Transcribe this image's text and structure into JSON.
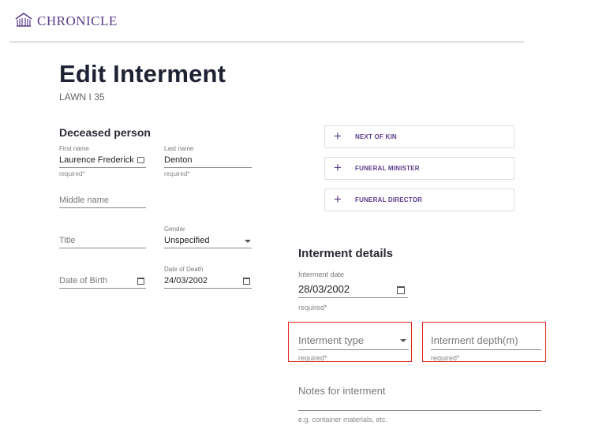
{
  "header": {
    "logo_text": "CHRONICLE",
    "logo_icon": "building-arches-icon",
    "brand_color": "#5b3d8a"
  },
  "page": {
    "title": "Edit Interment",
    "subtitle": "LAWN I 35"
  },
  "deceased": {
    "heading": "Deceased person",
    "first_name": {
      "label": "First name",
      "value": "Laurence Frederick",
      "hint": "required*"
    },
    "last_name": {
      "label": "Last name",
      "value": "Denton",
      "hint": "required*"
    },
    "middle_name": {
      "placeholder": "Middle name"
    },
    "title": {
      "placeholder": "Title"
    },
    "gender": {
      "label": "Gender",
      "value": "Unspecified"
    },
    "date_of_birth": {
      "placeholder": "Date of Birth"
    },
    "date_of_death": {
      "label": "Date of Death",
      "value": "24/03/2002"
    }
  },
  "contacts": {
    "next_of_kin": "NEXT OF KIN",
    "funeral_minister": "FUNERAL MINISTER",
    "funeral_director": "FUNERAL DIRECTOR"
  },
  "interment": {
    "heading": "Interment details",
    "date": {
      "label": "Interment date",
      "value": "28/03/2002",
      "hint": "required*"
    },
    "type": {
      "placeholder": "Interment type",
      "hint": "required*"
    },
    "depth": {
      "placeholder": "Interment depth(m)",
      "hint": "required*"
    },
    "notes": {
      "placeholder": "Notes for interment",
      "hint": "e.g. container materials, etc."
    }
  },
  "colors": {
    "highlight": "#e0261c",
    "accent": "#5b3d8a"
  }
}
